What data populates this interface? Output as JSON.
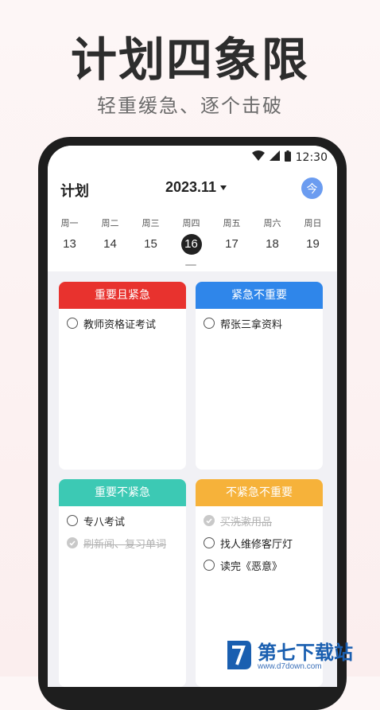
{
  "hero": {
    "title": "计划四象限",
    "subtitle": "轻重缓急、逐个击破"
  },
  "status": {
    "time": "12:30"
  },
  "header": {
    "title": "计划",
    "month": "2023.11",
    "today_label": "今"
  },
  "week": [
    {
      "name": "周一",
      "num": "13"
    },
    {
      "name": "周二",
      "num": "14"
    },
    {
      "name": "周三",
      "num": "15"
    },
    {
      "name": "周四",
      "num": "16"
    },
    {
      "name": "周五",
      "num": "17"
    },
    {
      "name": "周六",
      "num": "18"
    },
    {
      "name": "周日",
      "num": "19"
    }
  ],
  "selected_day": "16",
  "quadrants": [
    {
      "title": "重要且紧急",
      "color": "#e8322e",
      "tasks": [
        {
          "text": "教师资格证考试",
          "done": false
        }
      ]
    },
    {
      "title": "紧急不重要",
      "color": "#2f86ea",
      "tasks": [
        {
          "text": "帮张三拿资料",
          "done": false
        }
      ]
    },
    {
      "title": "重要不紧急",
      "color": "#3cc9b4",
      "tasks": [
        {
          "text": "专八考试",
          "done": false
        },
        {
          "text": "刷新闻、复习单词",
          "done": true
        }
      ]
    },
    {
      "title": "不紧急不重要",
      "color": "#f6b23a",
      "tasks": [
        {
          "text": "买洗漱用品",
          "done": true
        },
        {
          "text": "找人维修客厅灯",
          "done": false
        },
        {
          "text": "读完《恶意》",
          "done": false
        }
      ]
    }
  ],
  "watermark": {
    "text": "第七下载站",
    "url": "www.d7down.com"
  }
}
